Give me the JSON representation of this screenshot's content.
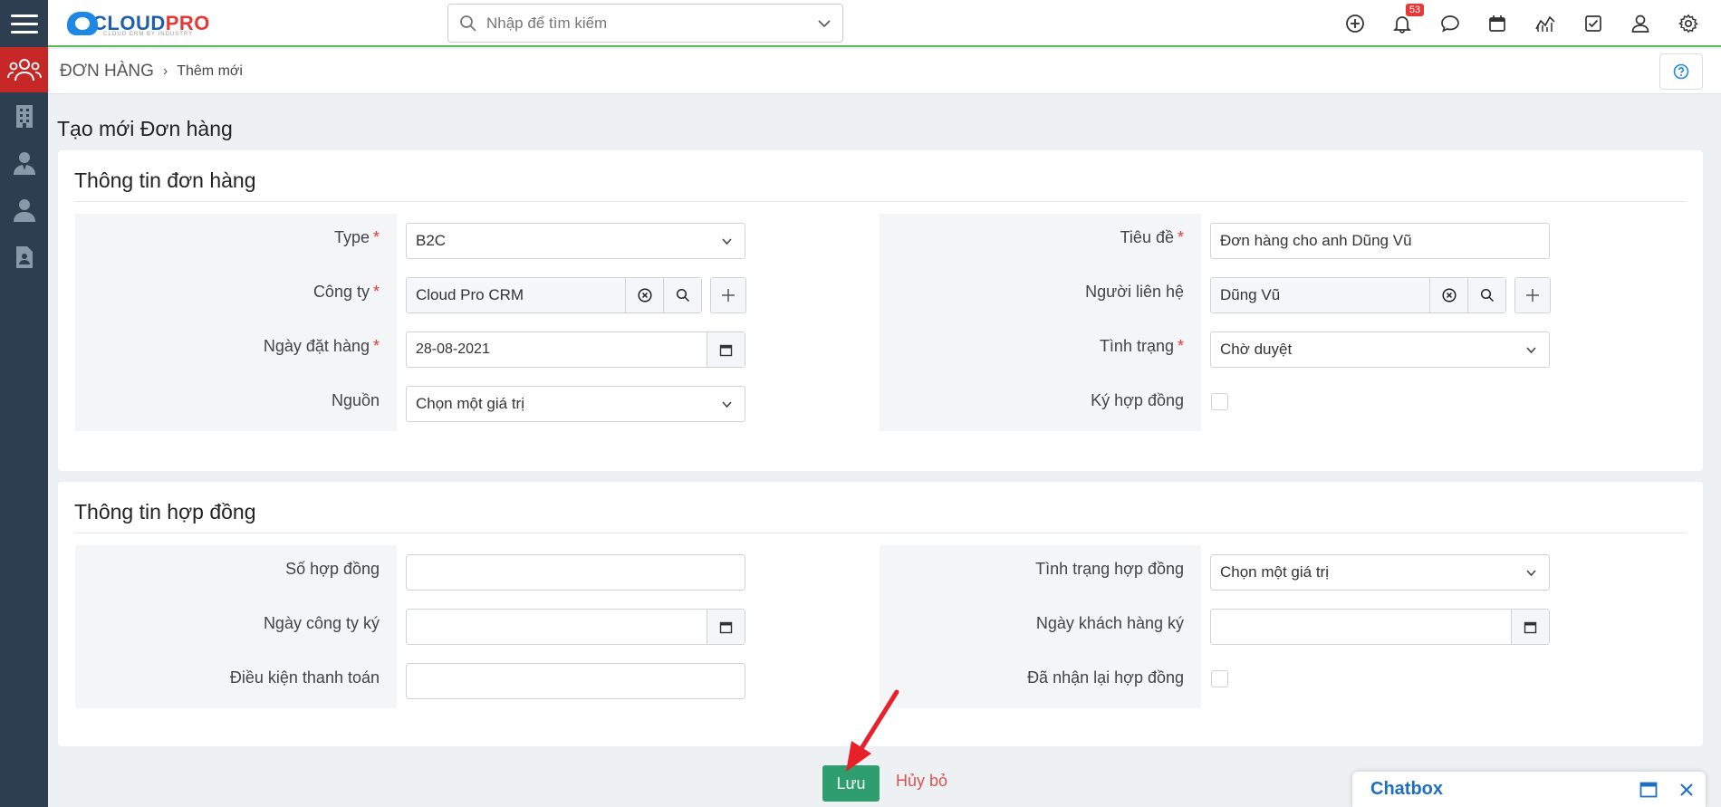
{
  "brand": {
    "logo_part1": "CLOUD",
    "logo_part2": "PRO",
    "logo_tagline": "CLOUD CRM BY INDUSTRY"
  },
  "search": {
    "placeholder": "Nhập để tìm kiếm"
  },
  "topbar": {
    "icons": [
      "add-circle-icon",
      "bell-icon",
      "chat-bubble-icon",
      "calendar-icon",
      "chart-icon",
      "checkbox-icon",
      "user-icon",
      "gear-icon"
    ],
    "notification_count": "53"
  },
  "sidebar": {
    "items": [
      "users-group-icon",
      "building-icon",
      "agent-icon",
      "person-icon",
      "contact-file-icon"
    ]
  },
  "breadcrumb": {
    "module": "ĐƠN HÀNG",
    "current": "Thêm mới"
  },
  "page": {
    "title": "Tạo mới Đơn hàng"
  },
  "order_info": {
    "heading": "Thông tin đơn hàng",
    "type_label": "Type",
    "type_value": "B2C",
    "company_label": "Công ty",
    "company_value": "Cloud Pro CRM",
    "order_date_label": "Ngày đặt hàng",
    "order_date_value": "28-08-2021",
    "source_label": "Nguồn",
    "source_value": "Chọn một giá trị",
    "title_label": "Tiêu đề",
    "title_value": "Đơn hàng cho anh Dũng Vũ",
    "contact_label": "Người liên hệ",
    "contact_value": "Dũng Vũ",
    "status_label": "Tình trạng",
    "status_value": "Chờ duyệt",
    "signed_label": "Ký hợp đồng"
  },
  "contract_info": {
    "heading": "Thông tin hợp đồng",
    "contract_no_label": "Số hợp đồng",
    "company_sign_date_label": "Ngày công ty ký",
    "payment_terms_label": "Điều kiện thanh toán",
    "contract_status_label": "Tình trạng hợp đồng",
    "contract_status_value": "Chọn một giá trị",
    "customer_sign_date_label": "Ngày khách hàng ký",
    "contract_received_label": "Đã nhận lại hợp đồng"
  },
  "actions": {
    "save": "Lưu",
    "cancel": "Hủy bỏ"
  },
  "chatbox": {
    "title": "Chatbox"
  },
  "colors": {
    "sidebar": "#2c3e50",
    "active": "#c62828",
    "save": "#2e9e6e",
    "cancel": "#d9534f",
    "accent_line": "#5cb85c"
  }
}
